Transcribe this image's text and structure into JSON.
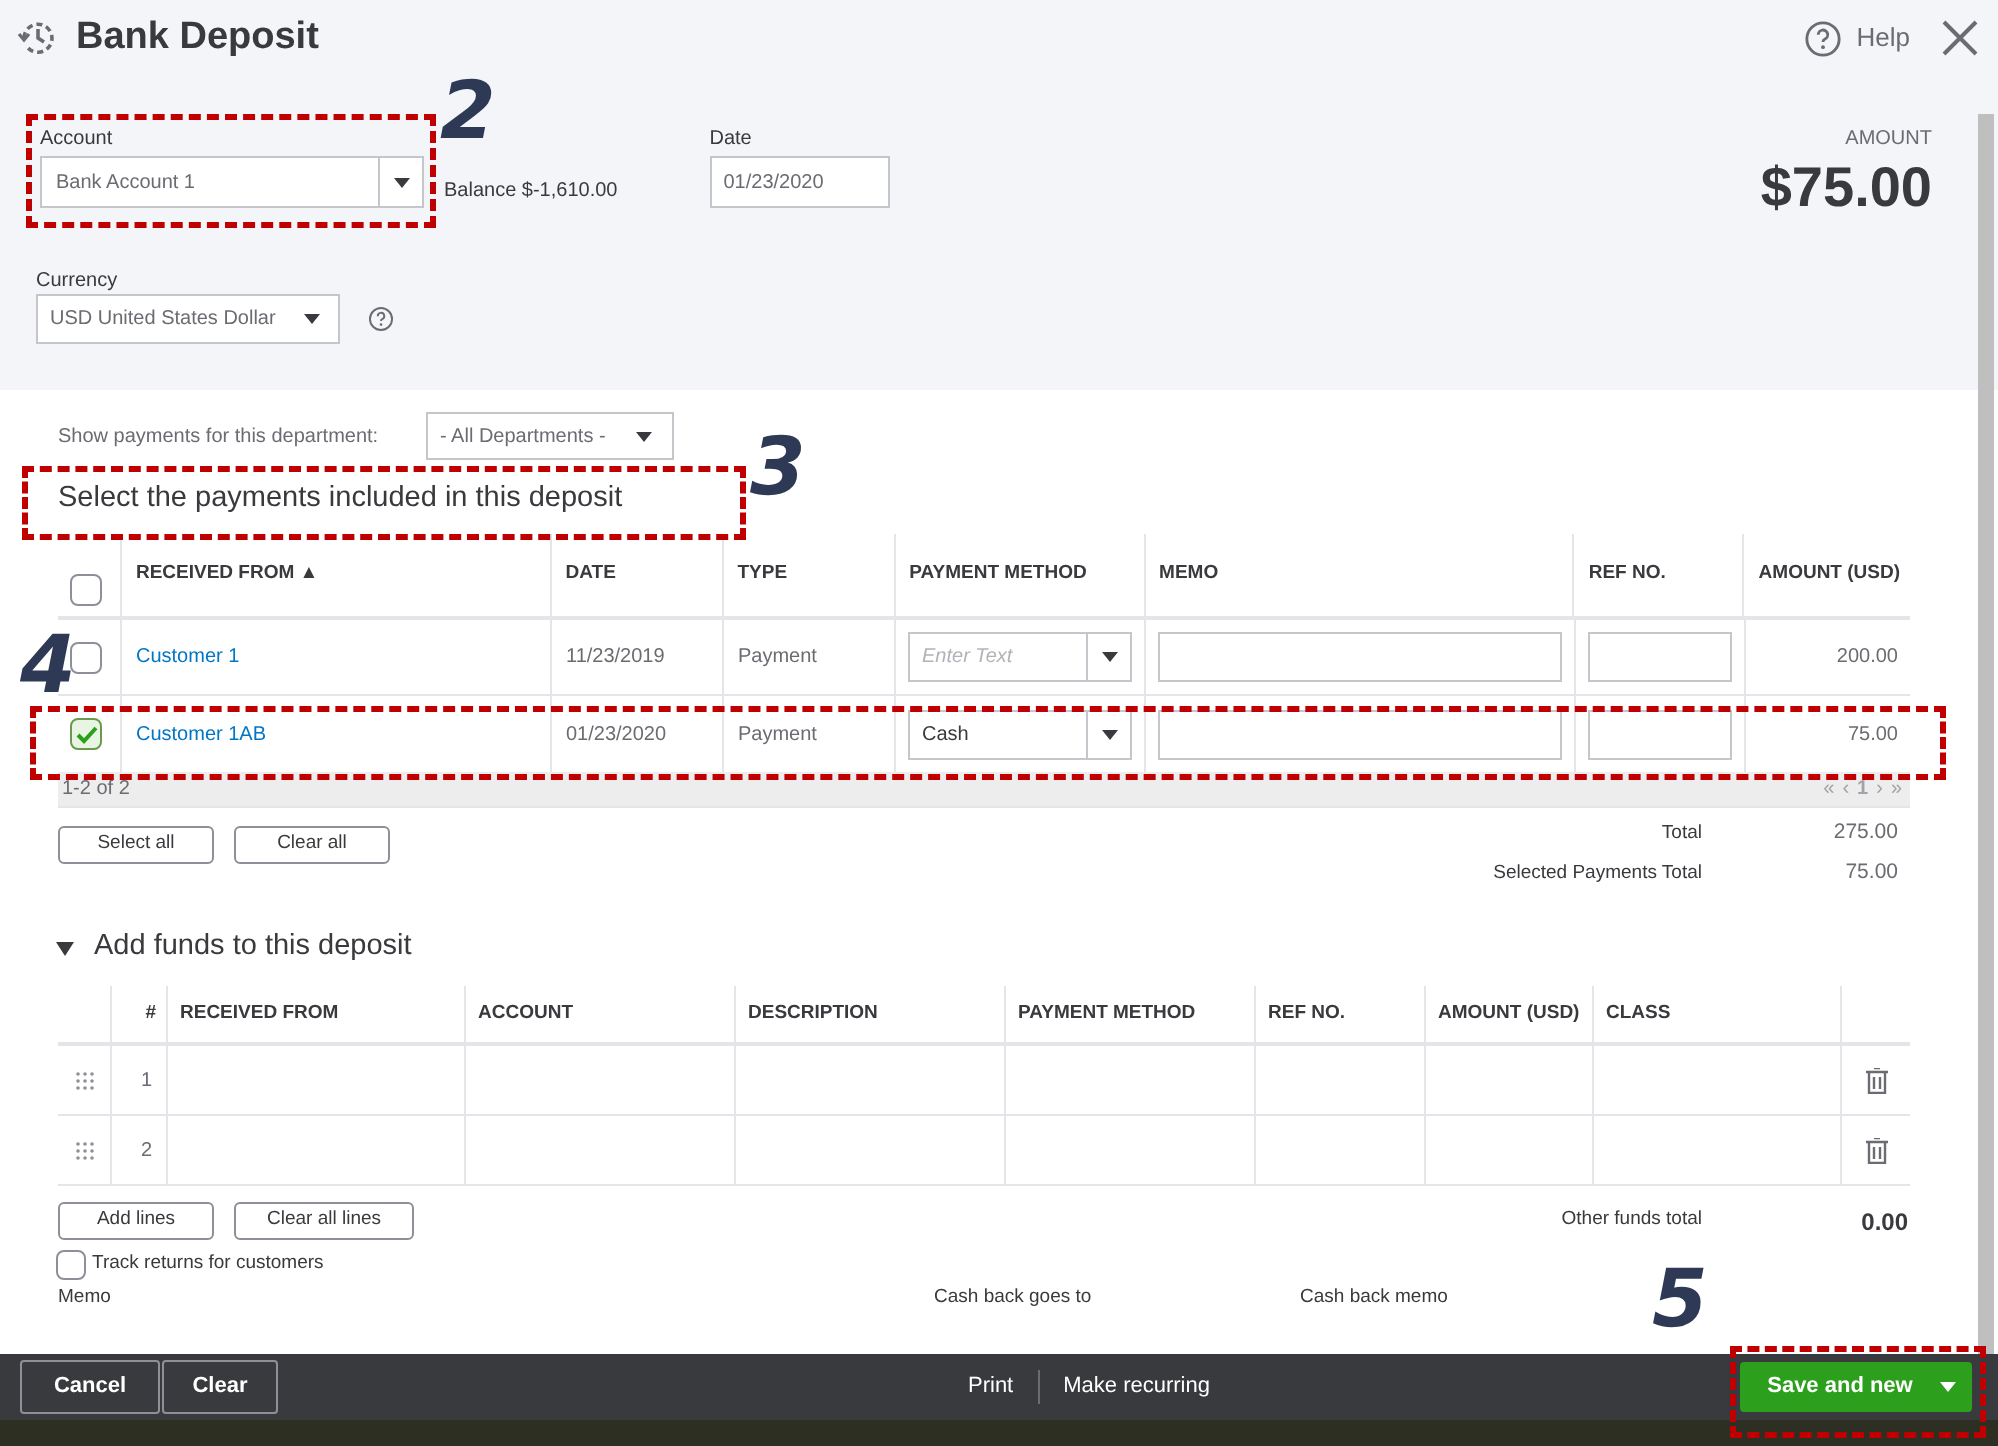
{
  "window": {
    "title": "Bank Deposit",
    "help": "Help"
  },
  "header": {
    "account": {
      "label": "Account",
      "value": "Bank Account 1"
    },
    "balance": "Balance $-1,610.00",
    "date": {
      "label": "Date",
      "value": "01/23/2020"
    },
    "amount_label": "AMOUNT",
    "amount": "$75.00",
    "currency": {
      "label": "Currency",
      "value": "USD United States Dollar"
    }
  },
  "department": {
    "label": "Show payments for this department:",
    "value": "- All Departments -"
  },
  "payments": {
    "heading": "Select the payments included in this deposit",
    "all_checked": false,
    "columns": [
      "RECEIVED FROM ▲",
      "DATE",
      "TYPE",
      "PAYMENT METHOD",
      "MEMO",
      "REF NO.",
      "AMOUNT (USD)"
    ],
    "rows": [
      {
        "checked": false,
        "received_from": "Customer 1",
        "date": "11/23/2019",
        "type": "Payment",
        "payment_method": {
          "placeholder": "Enter Text"
        },
        "amount": "200.00"
      },
      {
        "checked": true,
        "received_from": "Customer 1AB",
        "date": "01/23/2020",
        "type": "Payment",
        "payment_method": {
          "value": "Cash"
        },
        "amount": "75.00"
      }
    ],
    "count": "1-2 of 2",
    "pager": [
      "«",
      "‹",
      "1",
      "›",
      "»"
    ],
    "buttons": [
      "Select all",
      "Clear all"
    ],
    "totals": [
      {
        "label": "Total",
        "value": "275.00"
      },
      {
        "label": "Selected Payments Total",
        "value": "75.00"
      }
    ]
  },
  "funds": {
    "heading": "Add funds to this deposit",
    "expanded": true,
    "columns": [
      "#",
      "RECEIVED FROM",
      "ACCOUNT",
      "DESCRIPTION",
      "PAYMENT METHOD",
      "REF NO.",
      "AMOUNT (USD)",
      "CLASS"
    ],
    "rows": [
      {
        "number": "1"
      },
      {
        "number": "2"
      }
    ],
    "buttons": [
      "Add lines",
      "Clear all lines"
    ],
    "total_label": "Other funds total",
    "total": "0.00",
    "track_returns": {
      "label": "Track returns for customers",
      "checked": false
    }
  },
  "lower_labels": [
    "Memo",
    "Cash back goes to",
    "Cash back memo"
  ],
  "footer": {
    "left": [
      "Cancel",
      "Clear"
    ],
    "center": [
      "Print",
      "Make recurring"
    ],
    "primary": "Save and new"
  },
  "callouts": [
    {
      "number": "2"
    },
    {
      "number": "3"
    },
    {
      "number": "4"
    },
    {
      "number": "5"
    }
  ]
}
